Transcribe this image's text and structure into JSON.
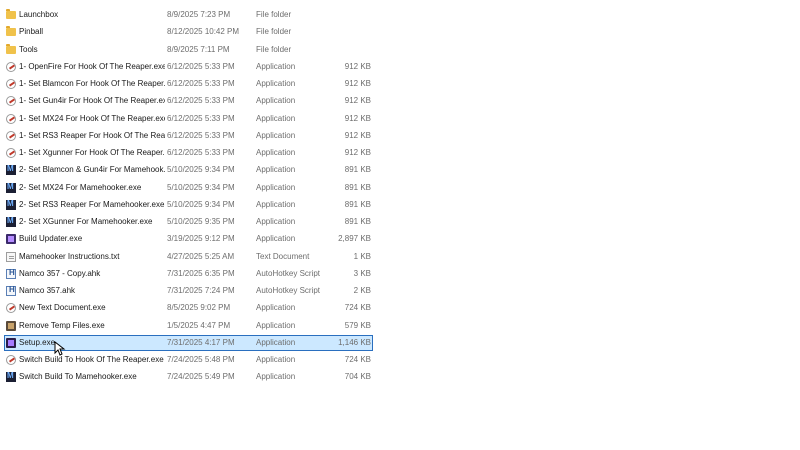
{
  "rows": [
    {
      "name": "Launchbox",
      "date": "8/9/2025 7:23 PM",
      "type": "File folder",
      "size": "",
      "icon": "folder"
    },
    {
      "name": "Pinball",
      "date": "8/12/2025 10:42 PM",
      "type": "File folder",
      "size": "",
      "icon": "folder"
    },
    {
      "name": "Tools",
      "date": "8/9/2025 7:11 PM",
      "type": "File folder",
      "size": "",
      "icon": "folder"
    },
    {
      "name": "1- OpenFire For Hook Of The Reaper.exe",
      "date": "6/12/2025 5:33 PM",
      "type": "Application",
      "size": "912 KB",
      "icon": "gun"
    },
    {
      "name": "1- Set Blamcon For Hook Of The Reaper....",
      "date": "6/12/2025 5:33 PM",
      "type": "Application",
      "size": "912 KB",
      "icon": "gun"
    },
    {
      "name": "1- Set Gun4ir For Hook Of The Reaper.exe",
      "date": "6/12/2025 5:33 PM",
      "type": "Application",
      "size": "912 KB",
      "icon": "gun"
    },
    {
      "name": "1- Set MX24 For Hook Of The Reaper.exe",
      "date": "6/12/2025 5:33 PM",
      "type": "Application",
      "size": "912 KB",
      "icon": "gun"
    },
    {
      "name": "1- Set RS3 Reaper For Hook Of The Reape...",
      "date": "6/12/2025 5:33 PM",
      "type": "Application",
      "size": "912 KB",
      "icon": "gun"
    },
    {
      "name": "1- Set Xgunner For Hook Of The Reaper.e...",
      "date": "6/12/2025 5:33 PM",
      "type": "Application",
      "size": "912 KB",
      "icon": "gun"
    },
    {
      "name": "2- Set Blamcon & Gun4ir For Mamehook...",
      "date": "5/10/2025 9:34 PM",
      "type": "Application",
      "size": "891 KB",
      "icon": "mame"
    },
    {
      "name": "2- Set MX24 For Mamehooker.exe",
      "date": "5/10/2025 9:34 PM",
      "type": "Application",
      "size": "891 KB",
      "icon": "mame"
    },
    {
      "name": "2- Set RS3 Reaper For Mamehooker.exe",
      "date": "5/10/2025 9:34 PM",
      "type": "Application",
      "size": "891 KB",
      "icon": "mame"
    },
    {
      "name": "2- Set XGunner For Mamehooker.exe",
      "date": "5/10/2025 9:35 PM",
      "type": "Application",
      "size": "891 KB",
      "icon": "mame"
    },
    {
      "name": "Build Updater.exe",
      "date": "3/19/2025 9:12 PM",
      "type": "Application",
      "size": "2,897 KB",
      "icon": "build"
    },
    {
      "name": "Mamehooker Instructions.txt",
      "date": "4/27/2025 5:25 AM",
      "type": "Text Document",
      "size": "1 KB",
      "icon": "txt"
    },
    {
      "name": "Namco 357 - Copy.ahk",
      "date": "7/31/2025 6:35 PM",
      "type": "AutoHotkey Script",
      "size": "3 KB",
      "icon": "ahk"
    },
    {
      "name": "Namco 357.ahk",
      "date": "7/31/2025 7:24 PM",
      "type": "AutoHotkey Script",
      "size": "2 KB",
      "icon": "ahk"
    },
    {
      "name": "New Text Document.exe",
      "date": "8/5/2025 9:02 PM",
      "type": "Application",
      "size": "724 KB",
      "icon": "gun"
    },
    {
      "name": "Remove Temp Files.exe",
      "date": "1/5/2025 4:47 PM",
      "type": "Application",
      "size": "579 KB",
      "icon": "temp"
    },
    {
      "name": "Setup.exe",
      "date": "7/31/2025 4:17 PM",
      "type": "Application",
      "size": "1,146 KB",
      "icon": "setup",
      "selected": true
    },
    {
      "name": "Switch Build To Hook Of The Reaper.exe",
      "date": "7/24/2025 5:48 PM",
      "type": "Application",
      "size": "724 KB",
      "icon": "gun"
    },
    {
      "name": "Switch Build To Mamehooker.exe",
      "date": "7/24/2025 5:49 PM",
      "type": "Application",
      "size": "704 KB",
      "icon": "mame"
    }
  ],
  "colors": {
    "selection_bg": "#cce8ff",
    "selection_border": "#2a6fbf",
    "folder": "#f0c24b"
  }
}
